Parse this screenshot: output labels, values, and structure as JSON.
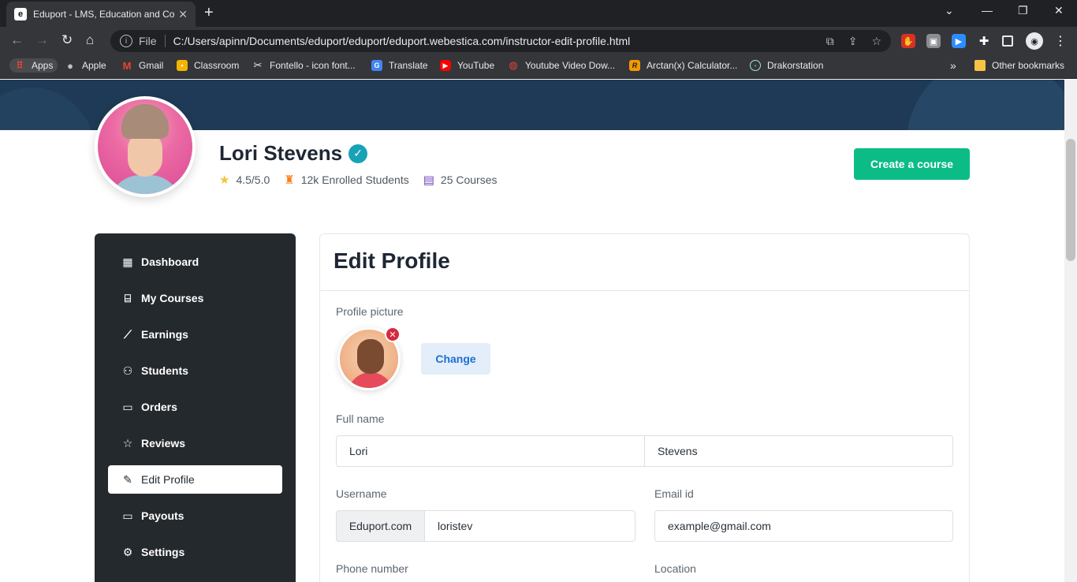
{
  "browser": {
    "tab_title": "Eduport - LMS, Education and Co",
    "favicon_letter": "e",
    "url_scheme_label": "File",
    "url": "C:/Users/apinn/Documents/eduport/eduport/eduport.webestica.com/instructor-edit-profile.html",
    "bookmarks": [
      {
        "label": "Apps",
        "icon": "apps-grid-icon"
      },
      {
        "label": "Apple",
        "icon": "apple-icon"
      },
      {
        "label": "Gmail",
        "icon": "gmail-icon"
      },
      {
        "label": "Classroom",
        "icon": "classroom-icon"
      },
      {
        "label": "Fontello - icon font...",
        "icon": "fontello-icon"
      },
      {
        "label": "Translate",
        "icon": "translate-icon"
      },
      {
        "label": "YouTube",
        "icon": "youtube-icon"
      },
      {
        "label": "Youtube Video Dow...",
        "icon": "location-pin-icon"
      },
      {
        "label": "Arctan(x) Calculator...",
        "icon": "r-logo-icon"
      },
      {
        "label": "Drakorstation",
        "icon": "drakor-icon"
      }
    ],
    "more_bookmarks": "»",
    "other_bookmarks": "Other bookmarks"
  },
  "profile": {
    "name": "Lori Stevens",
    "rating": "4.5/5.0",
    "enrolled": "12k Enrolled Students",
    "courses": "25 Courses",
    "create_course_label": "Create a course"
  },
  "sidebar": {
    "items": [
      {
        "label": "Dashboard",
        "icon": "dashboard-icon"
      },
      {
        "label": "My Courses",
        "icon": "basket-icon"
      },
      {
        "label": "Earnings",
        "icon": "graph-icon"
      },
      {
        "label": "Students",
        "icon": "people-icon"
      },
      {
        "label": "Orders",
        "icon": "folder-icon"
      },
      {
        "label": "Reviews",
        "icon": "star-icon"
      },
      {
        "label": "Edit Profile",
        "icon": "pencil-square-icon",
        "active": true
      },
      {
        "label": "Payouts",
        "icon": "wallet-icon"
      },
      {
        "label": "Settings",
        "icon": "gear-icon"
      }
    ]
  },
  "form": {
    "title": "Edit Profile",
    "profile_picture_label": "Profile picture",
    "change_label": "Change",
    "full_name_label": "Full name",
    "first_name": "Lori",
    "last_name": "Stevens",
    "username_label": "Username",
    "username_prefix": "Eduport.com",
    "username": "loristev",
    "email_label": "Email id",
    "email": "example@gmail.com",
    "phone_label": "Phone number",
    "location_label": "Location"
  },
  "colors": {
    "accent_green": "#0cbc87",
    "banner": "#1e3a56",
    "sidebar": "#24292d",
    "verified": "#17a2b8"
  }
}
